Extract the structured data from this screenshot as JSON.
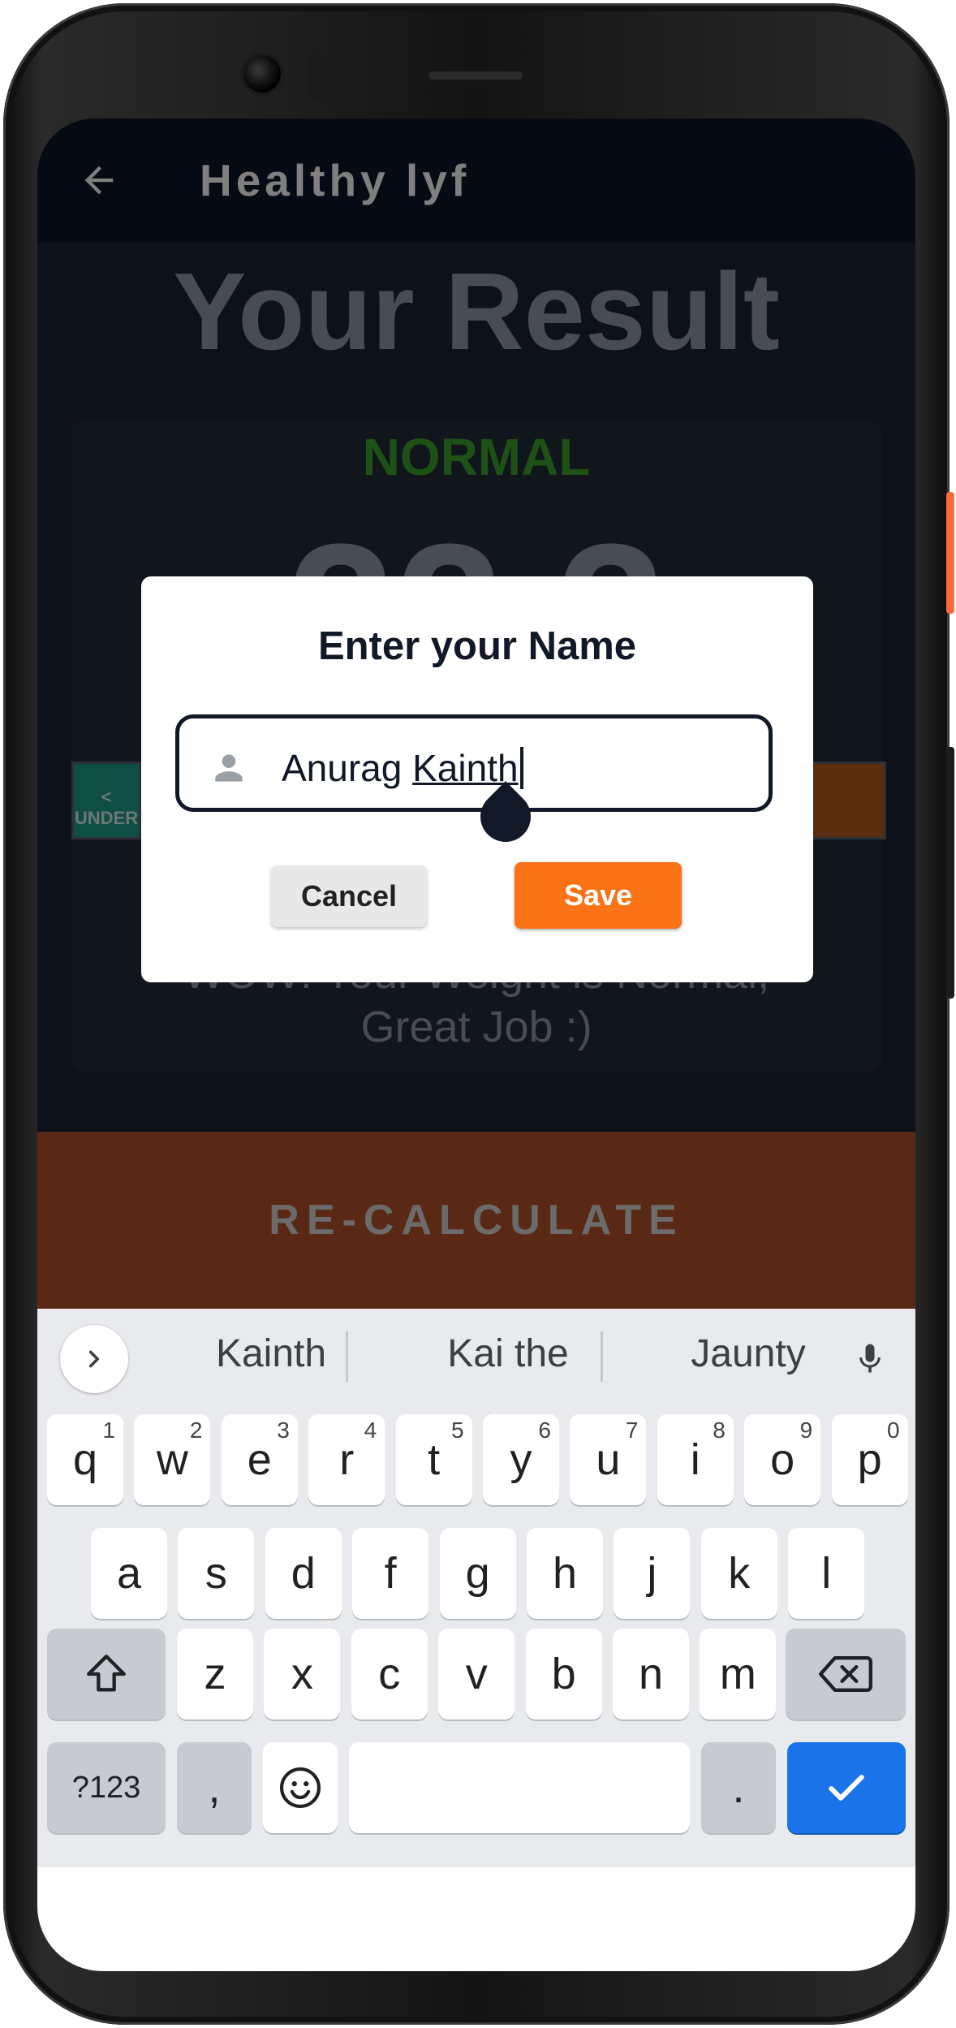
{
  "app_bar": {
    "title": "Healthy lyf"
  },
  "result": {
    "heading": "Your Result",
    "category": "NORMAL",
    "bmi": "22.3",
    "range_left_symbol": "<",
    "range_left_label": "UNDER",
    "message": "WOW! Your Weight is Normal, Great Job :)",
    "recalculate_label": "RE-CALCULATE"
  },
  "dialog": {
    "title": "Enter your Name",
    "name_field": {
      "value_plain": "Anurag ",
      "value_composing": "Kainth"
    },
    "cancel_label": "Cancel",
    "save_label": "Save"
  },
  "keyboard": {
    "suggestions": [
      "Kainth",
      "Kai the",
      "Jaunty"
    ],
    "row1": [
      {
        "k": "q",
        "h": "1"
      },
      {
        "k": "w",
        "h": "2"
      },
      {
        "k": "e",
        "h": "3"
      },
      {
        "k": "r",
        "h": "4"
      },
      {
        "k": "t",
        "h": "5"
      },
      {
        "k": "y",
        "h": "6"
      },
      {
        "k": "u",
        "h": "7"
      },
      {
        "k": "i",
        "h": "8"
      },
      {
        "k": "o",
        "h": "9"
      },
      {
        "k": "p",
        "h": "0"
      }
    ],
    "row2": [
      "a",
      "s",
      "d",
      "f",
      "g",
      "h",
      "j",
      "k",
      "l"
    ],
    "row3": [
      "z",
      "x",
      "c",
      "v",
      "b",
      "n",
      "m"
    ],
    "symbols_label": "?123",
    "comma_label": ",",
    "period_label": "."
  },
  "colors": {
    "accent_orange": "#fb7317",
    "normal_green": "#3aa22c",
    "keyboard_enter_blue": "#1a73e8"
  }
}
